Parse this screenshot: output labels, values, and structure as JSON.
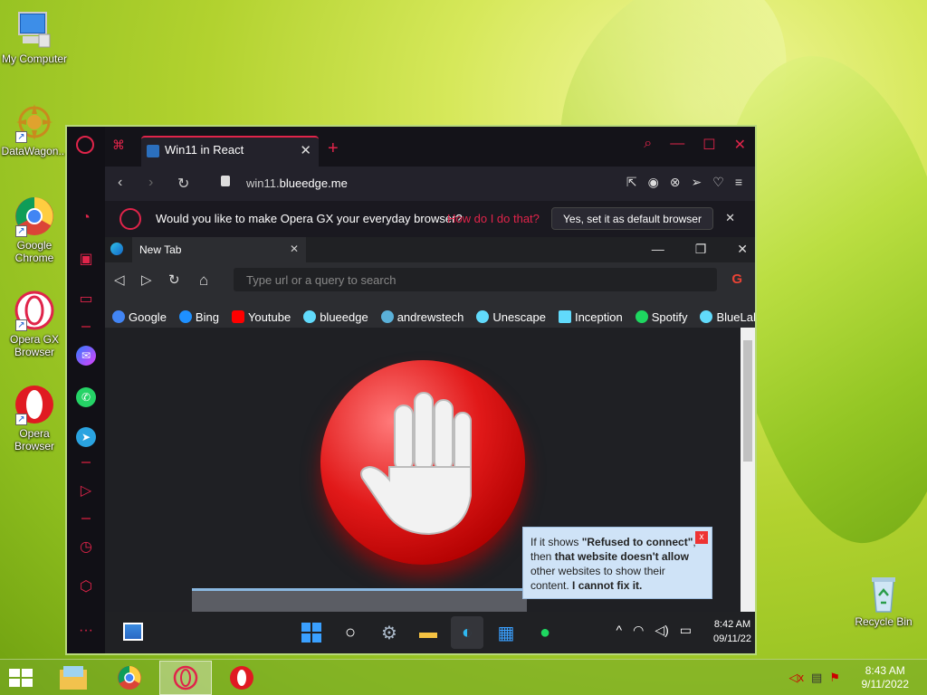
{
  "desktop": {
    "icons": [
      {
        "label": "My Computer",
        "icon": "computer-icon"
      },
      {
        "label": "DataWagon...",
        "icon": "datawagon-icon"
      },
      {
        "label": "Google Chrome",
        "icon": "chrome-icon"
      },
      {
        "label": "Opera GX Browser",
        "icon": "opera-gx-icon"
      },
      {
        "label": "Opera Browser",
        "icon": "opera-icon"
      },
      {
        "label": "Recycle Bin",
        "icon": "recycle-bin-icon"
      }
    ]
  },
  "opera_gx": {
    "tab_title": "Win11 in React",
    "url_domain": "win11.",
    "url_host": "blueedge.me",
    "default_prompt": {
      "question": "Would you like to make Opera GX your everyday browser?",
      "link": "How do I do that?",
      "button": "Yes, set it as default browser"
    }
  },
  "win11": {
    "tab_title": "New Tab",
    "search_placeholder": "Type url or a query to search",
    "bookmarks": [
      {
        "label": "Google",
        "color": "#4285f4"
      },
      {
        "label": "Bing",
        "color": "#1e90ff"
      },
      {
        "label": "Youtube",
        "color": "#ff0000"
      },
      {
        "label": "blueedge",
        "color": "#61dafb"
      },
      {
        "label": "andrewstech",
        "color": "#5ab0d8"
      },
      {
        "label": "Unescape",
        "color": "#61dafb"
      },
      {
        "label": "Inception",
        "color": "#61dafb"
      },
      {
        "label": "Spotify",
        "color": "#1ed760"
      },
      {
        "label": "BlueLab",
        "color": "#61dafb"
      }
    ],
    "tooltip": {
      "pre": "If it shows ",
      "quote": "\"Refused to connect\"",
      "mid": ", then ",
      "bold1": "that website doesn't allow",
      "rest": " other websites to show their content. ",
      "bold2": "I cannot fix it."
    },
    "clock_time": "8:42 AM",
    "clock_date": "09/11/22"
  },
  "taskbar": {
    "clock_time": "8:43 AM",
    "clock_date": "9/11/2022"
  }
}
